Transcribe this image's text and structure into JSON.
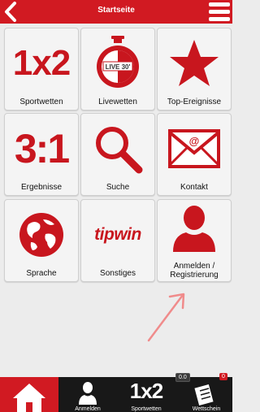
{
  "header": {
    "title": "Startseite"
  },
  "tiles": [
    {
      "label": "Sportwetten",
      "icon": "1x2-icon",
      "text": "1x2"
    },
    {
      "label": "Livewetten",
      "icon": "stopwatch-icon",
      "text": "LIVE 30'"
    },
    {
      "label": "Top-Ereignisse",
      "icon": "star-icon"
    },
    {
      "label": "Ergebnisse",
      "icon": "score-icon",
      "text": "3:1"
    },
    {
      "label": "Suche",
      "icon": "magnifier-icon"
    },
    {
      "label": "Kontakt",
      "icon": "envelope-icon",
      "text": "@"
    },
    {
      "label": "Sprache",
      "icon": "globe-icon"
    },
    {
      "label": "Sonstiges",
      "icon": "tipwin-logo",
      "text": "tipwin"
    },
    {
      "label_line1": "Anmelden /",
      "label_line2": "Registrierung",
      "icon": "user-icon"
    }
  ],
  "bottom_nav": {
    "home": {
      "icon": "home-icon"
    },
    "login": {
      "label": "Anmelden",
      "icon": "user-icon"
    },
    "sports": {
      "label": "Sportwetten",
      "icon": "1x2-icon",
      "text": "1x2"
    },
    "betslip": {
      "label": "Wettschein",
      "icon": "betslip-icon",
      "amount": "0.0",
      "count": "0"
    }
  },
  "colors": {
    "accent": "#d11a22",
    "dark": "#181818",
    "background": "#ececec"
  }
}
